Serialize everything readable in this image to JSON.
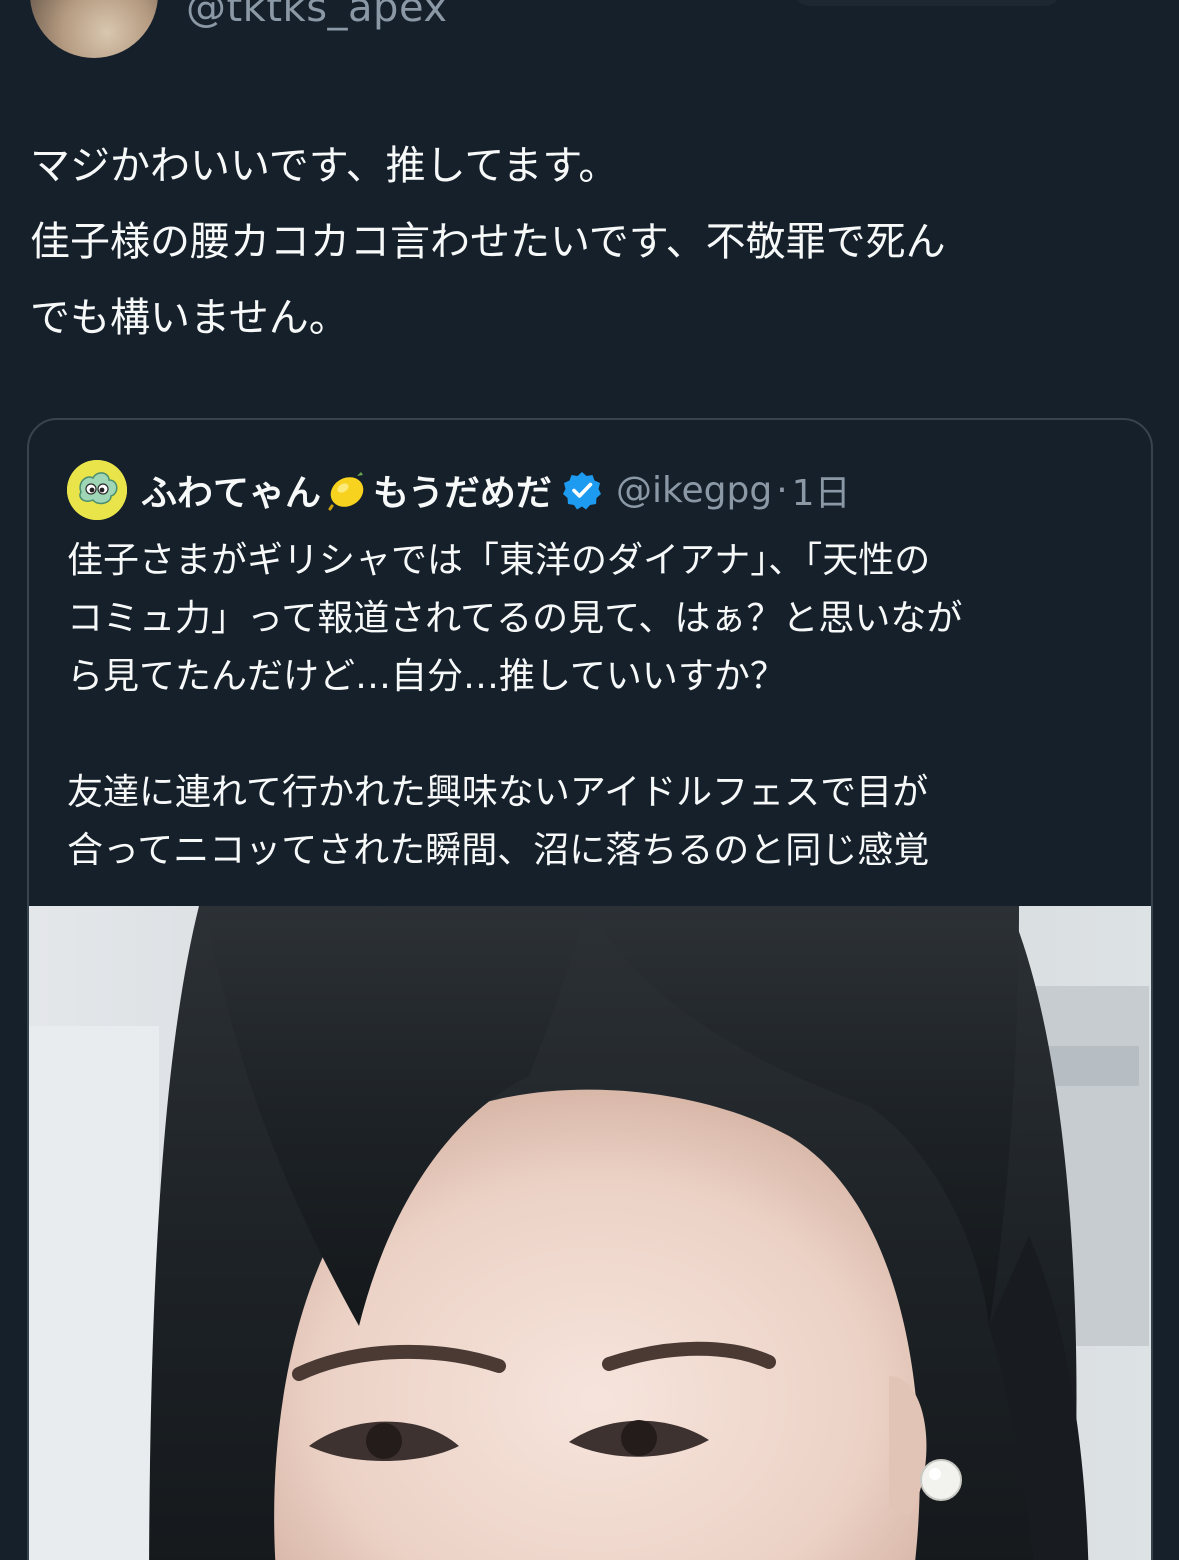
{
  "author": {
    "handle": "@tktks_apex"
  },
  "tweet": {
    "text": "マジかわいいです、推してます。\n佳子様の腰カコカコ言わせたいです、不敬罪で死ん\nでも構いません。"
  },
  "quoted": {
    "name_part1": "ふわてゃん",
    "name_part2": "もうだめだ",
    "handle": "@ikegpg",
    "separator": "·",
    "time": "1日",
    "text": "佳子さまがギリシャでは「東洋のダイアナ」、「天性の\nコミュ力」って報道されてるの見て、はぁ？と思いなが\nら見てたんだけど…自分…推していいすか？\n\n友達に連れて行かれた興味ないアイドルフェスで目が\n合ってニコッてされた瞬間、沼に落ちるのと同じ感覚"
  },
  "icons": {
    "lemon": "lemon-emoji-icon",
    "verified": "verified-badge-icon"
  },
  "colors": {
    "background": "#15202b",
    "text": "#f7f9f9",
    "secondary_text": "#8b98a5",
    "border": "#38444d",
    "verified": "#1d9bf0"
  }
}
